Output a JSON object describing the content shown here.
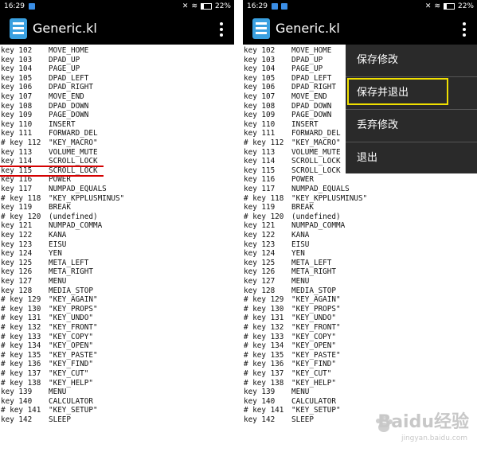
{
  "status_bar": {
    "time": "16:29",
    "battery": "22%"
  },
  "app_bar": {
    "title": "Generic.kl"
  },
  "key_rows": [
    {
      "id": "key 102",
      "name": "MOVE_HOME"
    },
    {
      "id": "key 103",
      "name": "DPAD_UP"
    },
    {
      "id": "key 104",
      "name": "PAGE_UP"
    },
    {
      "id": "key 105",
      "name": "DPAD_LEFT"
    },
    {
      "id": "key 106",
      "name": "DPAD_RIGHT"
    },
    {
      "id": "key 107",
      "name": "MOVE_END"
    },
    {
      "id": "key 108",
      "name": "DPAD_DOWN"
    },
    {
      "id": "key 109",
      "name": "PAGE_DOWN"
    },
    {
      "id": "key 110",
      "name": "INSERT"
    },
    {
      "id": "key 111",
      "name": "FORWARD_DEL"
    },
    {
      "id": "# key 112",
      "name": "\"KEY_MACRO\""
    },
    {
      "id": "key 113",
      "name": "VOLUME_MUTE"
    },
    {
      "id": "key 114",
      "name": "SCROLL_LOCK"
    },
    {
      "id": "key 115",
      "name": "SCROLL_LOCK"
    },
    {
      "id": "key 116",
      "name": "POWER"
    },
    {
      "id": "key 117",
      "name": "NUMPAD_EQUALS"
    },
    {
      "id": "# key 118",
      "name": "\"KEY_KPPLUSMINUS\""
    },
    {
      "id": "key 119",
      "name": "BREAK"
    },
    {
      "id": "# key 120",
      "name": "(undefined)"
    },
    {
      "id": "key 121",
      "name": "NUMPAD_COMMA"
    },
    {
      "id": "key 122",
      "name": "KANA"
    },
    {
      "id": "key 123",
      "name": "EISU"
    },
    {
      "id": "key 124",
      "name": "YEN"
    },
    {
      "id": "key 125",
      "name": "META_LEFT"
    },
    {
      "id": "key 126",
      "name": "META_RIGHT"
    },
    {
      "id": "key 127",
      "name": "MENU"
    },
    {
      "id": "key 128",
      "name": "MEDIA_STOP"
    },
    {
      "id": "# key 129",
      "name": "\"KEY_AGAIN\""
    },
    {
      "id": "# key 130",
      "name": "\"KEY_PROPS\""
    },
    {
      "id": "# key 131",
      "name": "\"KEY_UNDO\""
    },
    {
      "id": "# key 132",
      "name": "\"KEY_FRONT\""
    },
    {
      "id": "# key 133",
      "name": "\"KEY_COPY\""
    },
    {
      "id": "# key 134",
      "name": "\"KEY_OPEN\""
    },
    {
      "id": "# key 135",
      "name": "\"KEY_PASTE\""
    },
    {
      "id": "# key 136",
      "name": "\"KEY_FIND\""
    },
    {
      "id": "# key 137",
      "name": "\"KEY_CUT\""
    },
    {
      "id": "# key 138",
      "name": "\"KEY_HELP\""
    },
    {
      "id": "key 139",
      "name": "MENU"
    },
    {
      "id": "key 140",
      "name": "CALCULATOR"
    },
    {
      "id": "# key 141",
      "name": "\"KEY_SETUP\""
    },
    {
      "id": "key 142",
      "name": "SLEEP"
    }
  ],
  "menu": {
    "items": [
      {
        "label": "保存修改"
      },
      {
        "label": "保存并退出"
      },
      {
        "label": "丢弃修改"
      },
      {
        "label": "退出"
      }
    ]
  },
  "watermark": {
    "text": "Baidu经验",
    "url": "jingyan.baidu.com"
  },
  "colors": {
    "red_underline": "#d40000",
    "highlight_border": "#f0e000",
    "menu_bg": "#2a2a2a",
    "app_icon": "#3aa0e0"
  }
}
